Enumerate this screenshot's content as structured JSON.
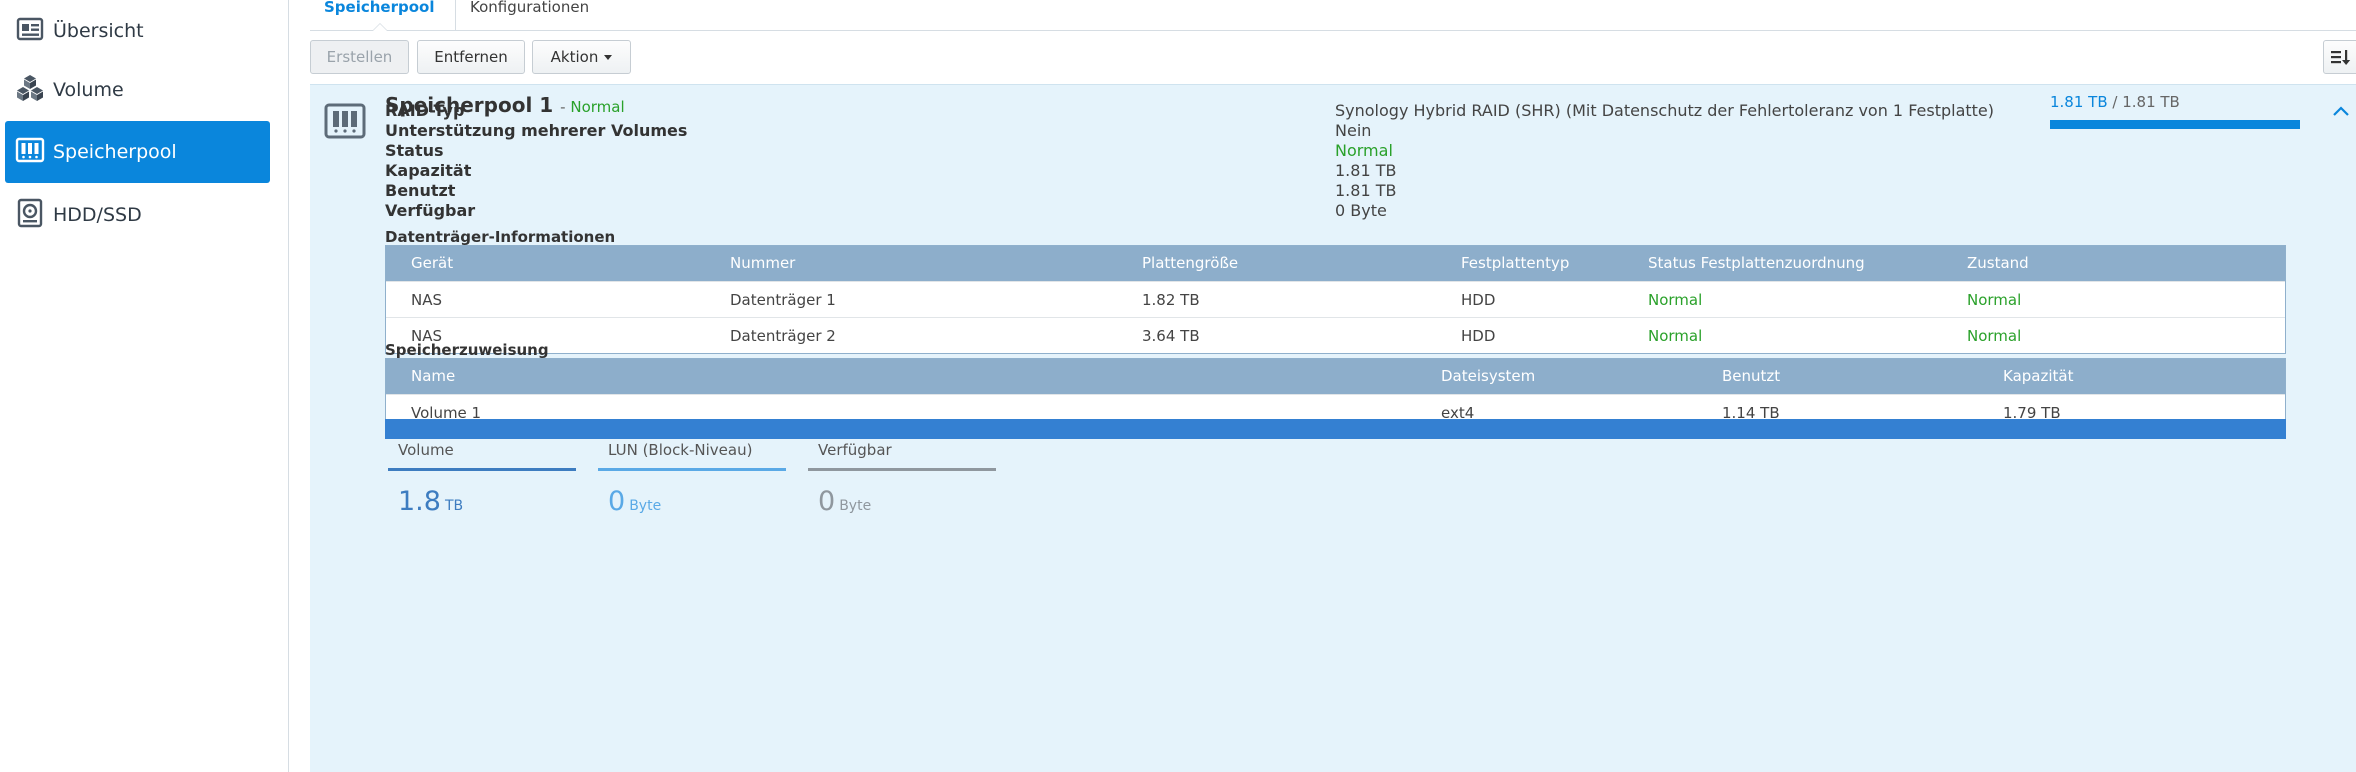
{
  "colors": {
    "accent": "#0a86dc",
    "status_ok": "#2aa12a",
    "panel_bg": "#e5f3fb",
    "table_header": "#8daecb",
    "volume": "#3d7cc0",
    "lun": "#5aa9e6",
    "available": "#8f979e"
  },
  "sidebar": {
    "items": [
      {
        "label": "Übersicht",
        "icon": "overview-icon",
        "active": false
      },
      {
        "label": "Volume",
        "icon": "volume-icon",
        "active": false
      },
      {
        "label": "Speicherpool",
        "icon": "storage-pool-icon",
        "active": true
      },
      {
        "label": "HDD/SSD",
        "icon": "hdd-icon",
        "active": false
      }
    ]
  },
  "tabs": [
    {
      "label": "Speicherpool",
      "active": true
    },
    {
      "label": "Konfigurationen",
      "active": false
    }
  ],
  "toolbar": {
    "create_label": "Erstellen",
    "remove_label": "Entfernen",
    "action_label": "Aktion",
    "sort_icon": "sort-icon"
  },
  "pool": {
    "name": "Speicherpool 1",
    "separator": "- ",
    "status": "Normal",
    "capacity_used": "1.81 TB",
    "capacity_sep": " / ",
    "capacity_total": "1.81 TB",
    "usage_fraction": 1.0,
    "properties": [
      {
        "label": "RAID-Typ",
        "value": "Synology Hybrid RAID (SHR) (Mit Datenschutz der Fehlertoleranz von 1 Festplatte)",
        "ok": false
      },
      {
        "label": "Unterstützung mehrerer Volumes",
        "value": "Nein",
        "ok": false
      },
      {
        "label": "Status",
        "value": "Normal",
        "ok": true
      },
      {
        "label": "Kapazität",
        "value": "1.81 TB",
        "ok": false
      },
      {
        "label": "Benutzt",
        "value": "1.81 TB",
        "ok": false
      },
      {
        "label": "Verfügbar",
        "value": "0 Byte",
        "ok": false
      }
    ]
  },
  "disk_info": {
    "title": "Datenträger-Informationen",
    "columns": [
      "Gerät",
      "Nummer",
      "Plattengröße",
      "Festplattentyp",
      "Status Festplattenzuordnung",
      "Zustand"
    ],
    "rows": [
      [
        "NAS",
        "Datenträger 1",
        "1.82 TB",
        "HDD",
        "Normal",
        "Normal"
      ],
      [
        "NAS",
        "Datenträger 2",
        "3.64 TB",
        "HDD",
        "Normal",
        "Normal"
      ]
    ]
  },
  "allocation": {
    "title": "Speicherzuweisung",
    "columns": [
      "Name",
      "Dateisystem",
      "Benutzt",
      "Kapazität"
    ],
    "rows": [
      [
        "Volume 1",
        "ext4",
        "1.14 TB",
        "1.79 TB"
      ]
    ]
  },
  "legend": [
    {
      "label": "Volume",
      "value": "1.8",
      "unit": "TB",
      "color": "#3d7cc0",
      "line": "#3d7cc0"
    },
    {
      "label": "LUN (Block-Niveau)",
      "value": "0",
      "unit": "Byte",
      "color": "#5aa9e6",
      "line": "#5aa9e6"
    },
    {
      "label": "Verfügbar",
      "value": "0",
      "unit": "Byte",
      "color": "#8f979e",
      "line": "#8f979e"
    }
  ]
}
